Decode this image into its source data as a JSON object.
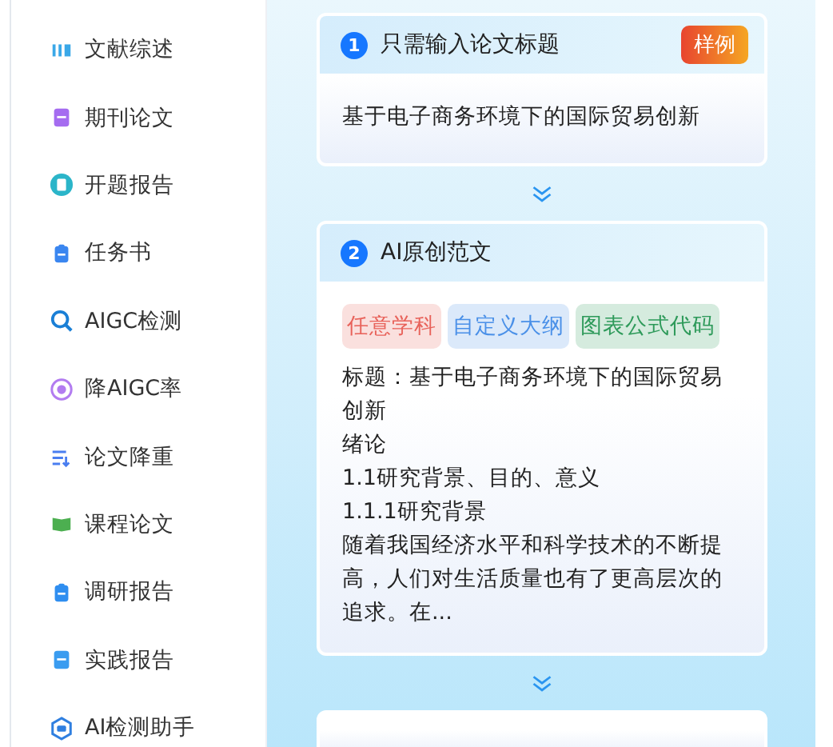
{
  "sidebar": {
    "items": [
      {
        "label": "文献综述",
        "kind": "bars",
        "color": "#3aa8e8"
      },
      {
        "label": "期刊论文",
        "kind": "doc",
        "color": "#a56cf0"
      },
      {
        "label": "开题报告",
        "kind": "circle-doc",
        "color": "#2bb5c9"
      },
      {
        "label": "任务书",
        "kind": "clipboard",
        "color": "#3a86f0"
      },
      {
        "label": "AIGC检测",
        "kind": "search",
        "color": "#1a7fd6"
      },
      {
        "label": "降AIGC率",
        "kind": "ai-circle",
        "color": "#b27cf0"
      },
      {
        "label": "论文降重",
        "kind": "list",
        "color": "#4a7ef0"
      },
      {
        "label": "课程论文",
        "kind": "book",
        "color": "#4caf50"
      },
      {
        "label": "调研报告",
        "kind": "clipboard",
        "color": "#2f8ef0"
      },
      {
        "label": "实践报告",
        "kind": "doc",
        "color": "#3a9cf0"
      },
      {
        "label": "AI检测助手",
        "kind": "ai-hex",
        "color": "#2f7fe0"
      }
    ]
  },
  "steps": [
    {
      "number": "1",
      "title": "只需输入论文标题",
      "badge": "样例",
      "text": "基于电子商务环境下的国际贸易创新"
    },
    {
      "number": "2",
      "title": "AI原创范文",
      "tags": [
        {
          "label": "任意学科",
          "color": "#e8625a"
        },
        {
          "label": "自定义大纲",
          "color": "#4a90e8"
        },
        {
          "label": "图表公式代码",
          "color": "#2e9a5a"
        }
      ],
      "lines": [
        "标题：基于电子商务环境下的国际贸易",
        "创新",
        "绪论",
        "1.1研究背景、目的、意义",
        "1.1.1研究背景",
        "随着我国经济水平和科学技术的不断提",
        "高，人们对生活质量也有了更高层次的",
        "追求。在..."
      ]
    }
  ]
}
